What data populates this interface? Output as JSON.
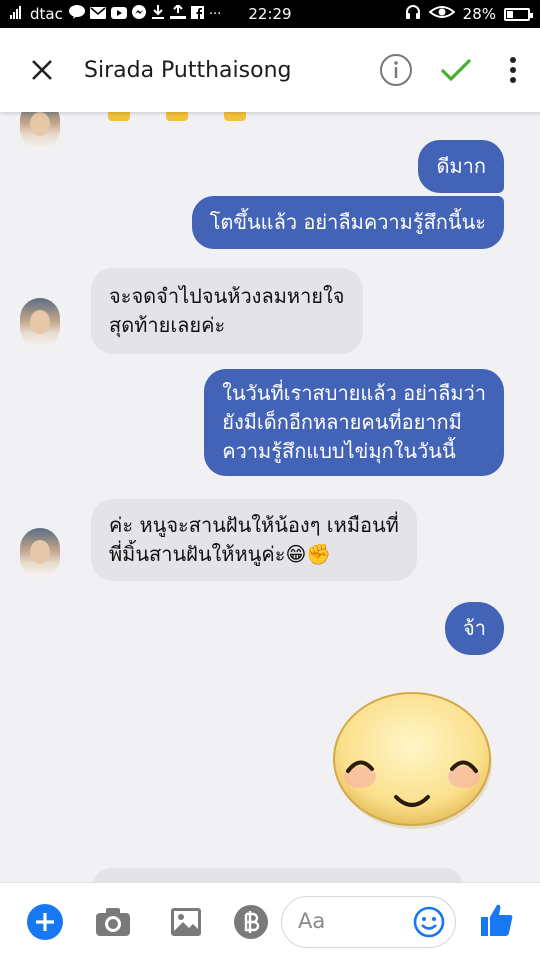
{
  "status_bar": {
    "carrier": "dtac",
    "time": "22:29",
    "battery": "28%",
    "battery_level": 0.28,
    "icons": [
      "signal-icon",
      "line-icon",
      "mail-icon",
      "youtube-icon",
      "messenger-icon",
      "download-icon",
      "notification-icon",
      "facebook-icon"
    ],
    "more": "···"
  },
  "header": {
    "title": "Sirada Putthaisong",
    "close_icon": "close-icon",
    "info_icon": "info-icon",
    "done_icon": "checkmark-icon",
    "menu_icon": "more-vertical-icon"
  },
  "colors": {
    "my_bubble": "#4363b6",
    "their_bubble": "#e4e4e8",
    "accent": "#1877f2",
    "check": "#43b12b"
  },
  "messages": [
    {
      "from": "me",
      "lines": [
        "ดีมาก"
      ]
    },
    {
      "from": "me",
      "lines": [
        "โตขึ้นแล้ว อย่าลืมความรู้สึกนี้นะ"
      ]
    },
    {
      "from": "them",
      "lines": [
        "จะจดจำไปจนห้วงลมหายใจ",
        "สุดท้ายเลยค่ะ"
      ]
    },
    {
      "from": "me",
      "lines": [
        "ในวันที่เราสบายแล้ว อย่าลืมว่า",
        "ยังมีเด็กอีกหลายคนที่อยากมี",
        "ความรู้สึกแบบไข่มุกในวันนี้"
      ]
    },
    {
      "from": "them",
      "lines": [
        "ค่ะ หนูจะสานฝันให้น้องๆ เหมือนที่",
        "พี่มิ้นสานฝันให้หนูค่ะ😁✊"
      ]
    },
    {
      "from": "me",
      "lines": [
        "จ้า"
      ]
    },
    {
      "from": "me",
      "sticker": "smiling-face-sticker"
    }
  ],
  "composer": {
    "placeholder": "Aa",
    "icons": [
      "add-icon",
      "camera-icon",
      "gallery-icon",
      "payment-icon",
      "emoji-icon",
      "thumbs-up-icon"
    ]
  }
}
